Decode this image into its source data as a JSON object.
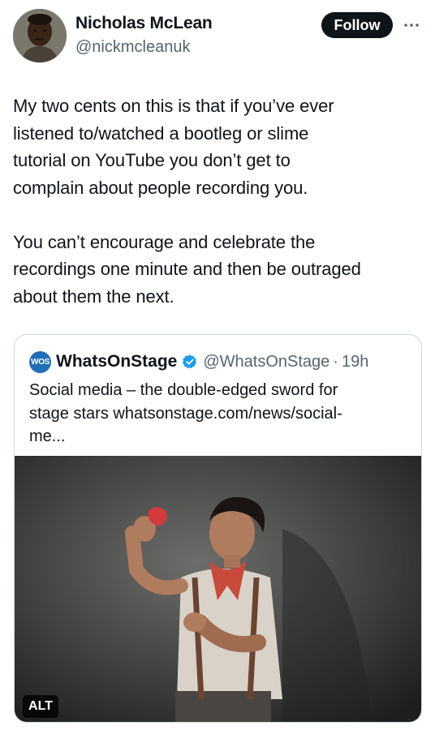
{
  "author": {
    "name": "Nicholas McLean",
    "handle": "@nickmcleanuk"
  },
  "follow_label": "Follow",
  "tweet": {
    "paragraph1": [
      "My two cents on this is that if you’ve ever",
      "listened to/watched a bootleg or slime",
      "tutorial on YouTube you don’t get to",
      "complain about people recording you."
    ],
    "paragraph2": [
      "You can’t encourage and celebrate the",
      "recordings one minute and then be outraged",
      "about them the next."
    ]
  },
  "quote": {
    "logo_text": "WOS",
    "name": "WhatsOnStage",
    "handle": "@WhatsOnStage",
    "separator": "·",
    "time": "19h",
    "text_lines": [
      "Social media – the double-edged sword for",
      "stage stars whatsonstage.com/news/social-",
      "me..."
    ],
    "alt_label": "ALT"
  },
  "colors": {
    "text": "#0f1419",
    "secondary": "#536471",
    "border": "#cfd9de",
    "verified": "#1d9bf0",
    "brand": "#1f6fb8"
  },
  "icons": {
    "more": "more-icon",
    "verified": "verified-badge-icon"
  }
}
